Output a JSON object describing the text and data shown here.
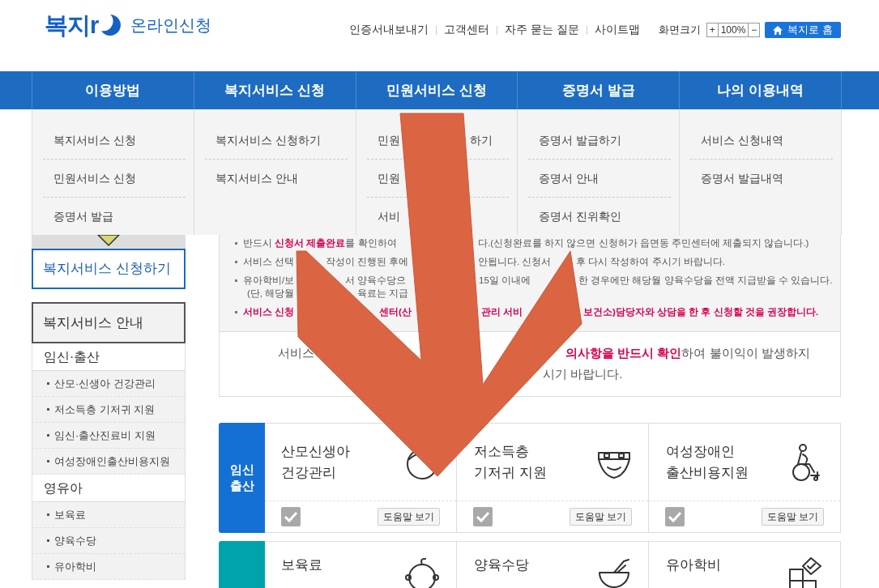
{
  "header": {
    "logo": "복지r",
    "subtitle": "온라인신청",
    "links": [
      "인증서내보내기",
      "고객센터",
      "자주 묻는 질문",
      "사이트맵"
    ],
    "zoom_label": "화면크기",
    "zoom_in": "+",
    "zoom_value": "100%",
    "zoom_out": "−",
    "home": "복지로 홈"
  },
  "nav": [
    {
      "label": "이용방법",
      "items": [
        [
          "복지서비스 신청"
        ],
        [
          "민원서비스 신청"
        ],
        [
          "증명서 발급"
        ]
      ]
    },
    {
      "label": "복지서비스 신청",
      "items": [
        [
          "복지서비스 신청하기"
        ],
        [
          "복지서비스 안내"
        ]
      ]
    },
    {
      "label": "민원서비스 신청",
      "items": [
        [
          "민원",
          "하기"
        ],
        [
          "민원"
        ],
        [
          "서비"
        ]
      ]
    },
    {
      "label": "증명서 발급",
      "items": [
        [
          "증명서 발급하기"
        ],
        [
          "증명서 안내"
        ],
        [
          "증명서 진위확인"
        ]
      ]
    },
    {
      "label": "나의 이용내역",
      "items": [
        [
          "서비스 신청내역"
        ],
        [
          "증명서 발급내역"
        ]
      ]
    }
  ],
  "sidebar": {
    "apply": "복지서비스 신청하기",
    "guide": "복지서비스 안내",
    "categories": [
      {
        "title": "임신·출산",
        "items": [
          "산모·신생아 건강관리",
          "저소득층 기저귀 지원",
          "임신·출산진료비 지원",
          "여성장애인출산비용지원"
        ]
      },
      {
        "title": "영유아",
        "items": [
          "보육료",
          "양육수당",
          "유아학비"
        ]
      }
    ]
  },
  "notice": {
    "lines": [
      {
        "bullet": true,
        "emphasis": false,
        "parts": [
          "반드시 **신청서 제출완료**를 확인하여",
          "다.(신청완료를 하지 않으면 신청허가 읍면동 주민센터에 제출되지 않습니다.)"
        ]
      },
      {
        "bullet": true,
        "emphasis": false,
        "parts": [
          "서비스 선택",
          "작성이 진행된 후에",
          "안됩니다. 신청서",
          "후 다시 작성하여 주시기 바랍니다."
        ]
      },
      {
        "bullet": true,
        "emphasis": false,
        "parts": [
          "유아학비/보",
          "서 양육수당으",
          "15일 이내에",
          "한 경우에만 해당월 양육수당을 전액 지급받을 수 있습니다."
        ]
      },
      {
        "bullet": false,
        "emphasis": false,
        "parts": [
          "(단, 해당월",
          "육료는 지급"
        ]
      },
      {
        "bullet": true,
        "emphasis": true,
        "parts": [
          "서비스 신청",
          "센터(산",
          "관리 서비",
          "보건소)담당자와 상담을 한 후 신청할 것을 권장합니다."
        ]
      }
    ],
    "box_lines": [
      [
        "서비스",
        "**의사항을 반드시 확인**하여 불이익이 발생하지"
      ],
      [
        "시기 바랍니다."
      ]
    ]
  },
  "services": [
    {
      "category": [
        "임신",
        "출산"
      ],
      "color": "#1570d5",
      "cards": [
        {
          "title": [
            "산모신생아",
            "건강관리"
          ],
          "checked": true,
          "help": "도움말 보기"
        },
        {
          "title": [
            "저소득층",
            "기저귀 지원"
          ],
          "checked": true,
          "help": "도움말 보기"
        },
        {
          "title": [
            "여성장애인",
            "출산비용지원"
          ],
          "checked": true,
          "help": "도움말 보기"
        }
      ]
    },
    {
      "color": "#00a3a9",
      "cards": [
        {
          "title": [
            "보육료"
          ]
        },
        {
          "title": [
            "양육수당"
          ]
        },
        {
          "title": [
            "유아학비"
          ]
        }
      ]
    }
  ],
  "overlay": {
    "kind": "arrow"
  }
}
